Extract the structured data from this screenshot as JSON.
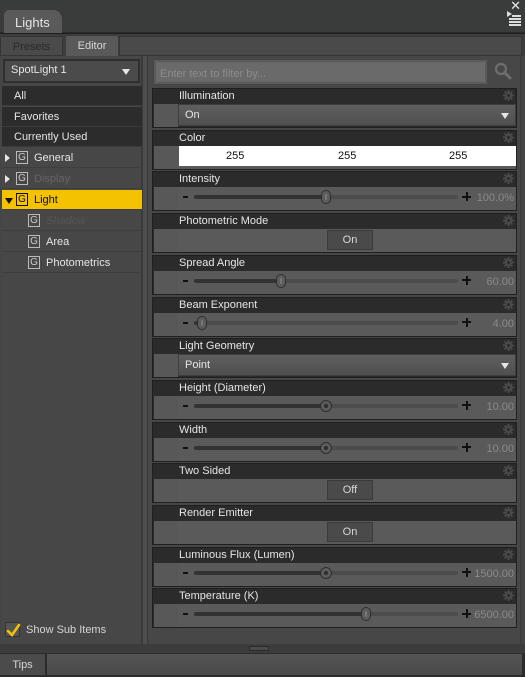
{
  "window": {
    "panel_tab": "Lights",
    "close_icon": "close-icon",
    "menu_icon": "panel-menu-icon"
  },
  "subtabs": [
    {
      "label": "Presets",
      "active": false
    },
    {
      "label": "Editor",
      "active": true
    }
  ],
  "left": {
    "node_select": "SpotLight 1",
    "fixed_items": [
      "All",
      "Favorites",
      "Currently Used"
    ],
    "tree": [
      {
        "label": "General",
        "expander": "right",
        "state": "normal",
        "indent": 0
      },
      {
        "label": "Display",
        "expander": "right",
        "state": "disabled",
        "indent": 0
      },
      {
        "label": "Light",
        "expander": "down",
        "state": "selected",
        "indent": 0
      },
      {
        "label": "Shadow",
        "expander": "",
        "state": "italic",
        "indent": 1
      },
      {
        "label": "Area",
        "expander": "",
        "state": "normal",
        "indent": 1
      },
      {
        "label": "Photometrics",
        "expander": "",
        "state": "normal",
        "indent": 1
      }
    ],
    "show_sub_items": {
      "label": "Show Sub Items",
      "checked": true
    }
  },
  "right": {
    "filter_placeholder": "Enter text to filter by...",
    "properties": [
      {
        "name": "Illumination",
        "type": "dropdown",
        "value": "On"
      },
      {
        "name": "Color",
        "type": "color",
        "rgb": [
          "255",
          "255",
          "255"
        ]
      },
      {
        "name": "Intensity",
        "type": "slider",
        "value": "100.0%",
        "fraction": 0.5,
        "thumb": "oval"
      },
      {
        "name": "Photometric Mode",
        "type": "toggle",
        "value": "On"
      },
      {
        "name": "Spread Angle",
        "type": "slider",
        "value": "60.00",
        "fraction": 0.33,
        "thumb": "oval"
      },
      {
        "name": "Beam Exponent",
        "type": "slider",
        "value": "4.00",
        "fraction": 0.03,
        "thumb": "oval"
      },
      {
        "name": "Light Geometry",
        "type": "dropdown",
        "value": "Point"
      },
      {
        "name": "Height (Diameter)",
        "type": "slider",
        "value": "10.00",
        "fraction": 0.5,
        "thumb": "round"
      },
      {
        "name": "Width",
        "type": "slider",
        "value": "10.00",
        "fraction": 0.5,
        "thumb": "round"
      },
      {
        "name": "Two Sided",
        "type": "toggle",
        "value": "Off"
      },
      {
        "name": "Render Emitter",
        "type": "toggle",
        "value": "On"
      },
      {
        "name": "Luminous Flux (Lumen)",
        "type": "slider",
        "value": "1500.00",
        "fraction": 0.5,
        "thumb": "round"
      },
      {
        "name": "Temperature (K)",
        "type": "slider",
        "value": "6500.00",
        "fraction": 0.65,
        "thumb": "oval"
      }
    ]
  },
  "bottom": {
    "tips_label": "Tips"
  },
  "colors": {
    "accent": "#f5c200",
    "background": "#474747",
    "property_header": "#2b2b2b"
  }
}
